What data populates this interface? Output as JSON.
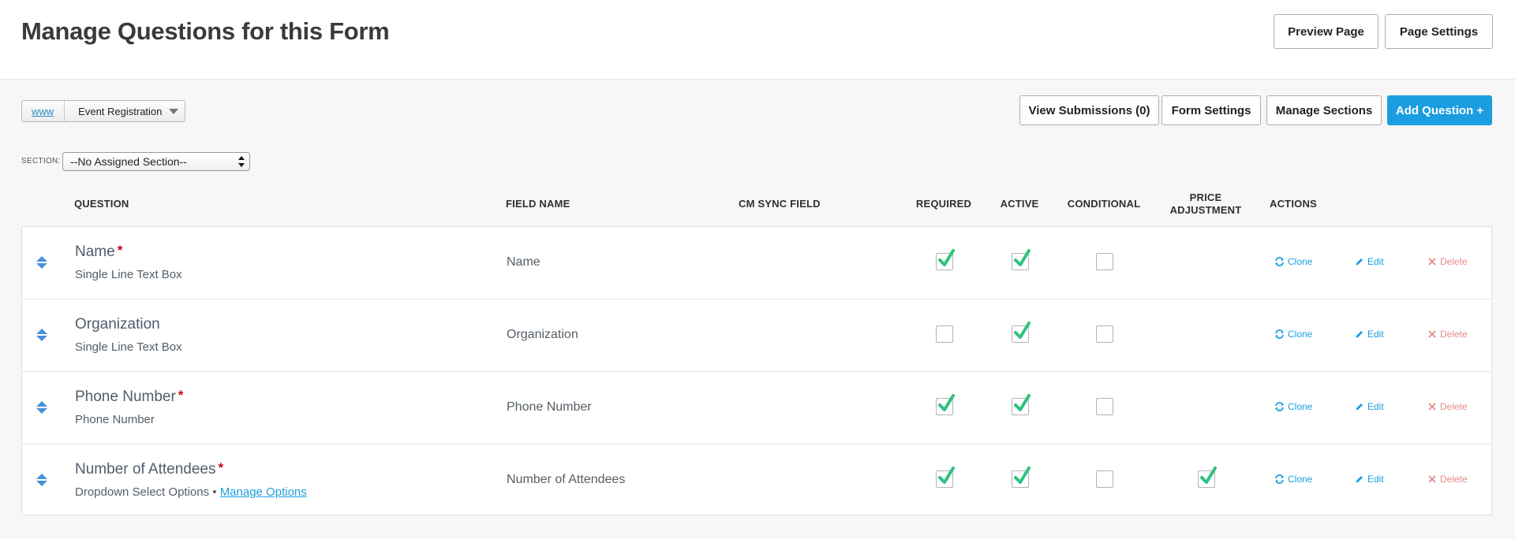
{
  "header": {
    "title": "Manage Questions for this Form",
    "preview_label": "Preview Page",
    "page_settings_label": "Page Settings"
  },
  "breadcrumb": {
    "home": "www",
    "current": "Event Registration"
  },
  "toolbar": {
    "view_submissions_label": "View Submissions (0)",
    "form_settings_label": "Form Settings",
    "manage_sections_label": "Manage Sections",
    "add_question_label": "Add Question +"
  },
  "section": {
    "label": "SECTION:",
    "selected": "--No Assigned Section--"
  },
  "columns": {
    "question": "QUESTION",
    "field_name": "FIELD NAME",
    "cm_sync": "CM SYNC FIELD",
    "required": "REQUIRED",
    "active": "ACTIVE",
    "conditional": "CONDITIONAL",
    "price_line1": "PRICE",
    "price_line2": "ADJUSTMENT",
    "actions": "ACTIONS"
  },
  "actions": {
    "clone": "Clone",
    "edit": "Edit",
    "delete": "Delete"
  },
  "rows": [
    {
      "name": "Name",
      "required_star": "*",
      "type": "Single Line Text Box",
      "type_link": "",
      "field_name": "Name",
      "required": true,
      "active": true,
      "conditional": false,
      "price_adjustment": null
    },
    {
      "name": "Organization",
      "required_star": "",
      "type": "Single Line Text Box",
      "type_link": "",
      "field_name": "Organization",
      "required": false,
      "active": true,
      "conditional": false,
      "price_adjustment": null
    },
    {
      "name": "Phone Number",
      "required_star": "*",
      "type": "Phone Number",
      "type_link": "",
      "field_name": "Phone Number",
      "required": true,
      "active": true,
      "conditional": false,
      "price_adjustment": null
    },
    {
      "name": "Number of Attendees",
      "required_star": "*",
      "type": "Dropdown Select Options •",
      "type_link": "Manage Options",
      "field_name": "Number of Attendees",
      "required": true,
      "active": true,
      "conditional": false,
      "price_adjustment": true
    }
  ],
  "colors": {
    "primary": "#1a9ee1",
    "check": "#2ec27e",
    "required_star": "#d0021b",
    "delete": "#e58a8a"
  }
}
